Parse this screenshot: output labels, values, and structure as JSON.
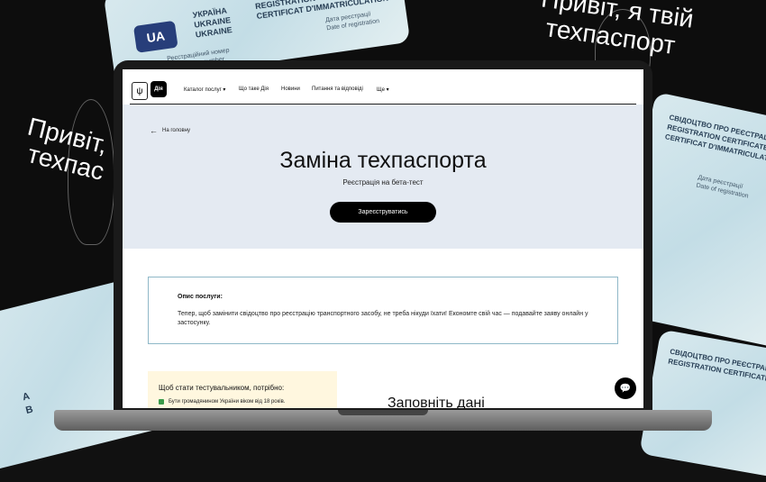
{
  "background": {
    "headline_top_right": [
      "Привіт, я твій",
      "техпаспорт"
    ],
    "headline_left": [
      "Привіт,",
      "техпас"
    ],
    "card_text": {
      "country_lines": [
        "УКРАЇНА",
        "UKRAINE",
        "UKRAINE"
      ],
      "registration_lines": [
        "СВІДОЦТВО ПРО РЕЄСТРАЦІЮ",
        "REGISTRATION CERTIFICATE",
        "CERTIFICAT D'IMMATRICULATION"
      ],
      "date_lines": [
        "Дата реєстрації",
        "Date of registration"
      ],
      "number_lines": [
        "Реєстраційний номер",
        "Registration number"
      ],
      "badge": "UA",
      "letters": [
        "A",
        "B"
      ]
    }
  },
  "header": {
    "emblem": "ψ",
    "logo": "Дія",
    "nav": [
      "Каталог послуг ▾",
      "Що таке Дія",
      "Новини",
      "Питання та відповіді",
      "Ще ▾"
    ]
  },
  "hero": {
    "back_label": "На головну",
    "back_arrow": "←",
    "title": "Заміна техпаспорта",
    "subtitle": "Реєстрація на бета-тест",
    "register_button": "Зареєструватись"
  },
  "description": {
    "title": "Опис послуги:",
    "text": "Тепер, щоб замінити свідоцтво про реєстрацію транспортного засобу, не треба нікуди їхати! Економте свій час — подавайте заяву онлайн у застосунку."
  },
  "tester": {
    "title": "Щоб стати тестувальником, потрібно:",
    "item": "Бути громадянином України віком від 18 років."
  },
  "form": {
    "title": "Заповніть дані"
  },
  "chat_icon": "💬"
}
